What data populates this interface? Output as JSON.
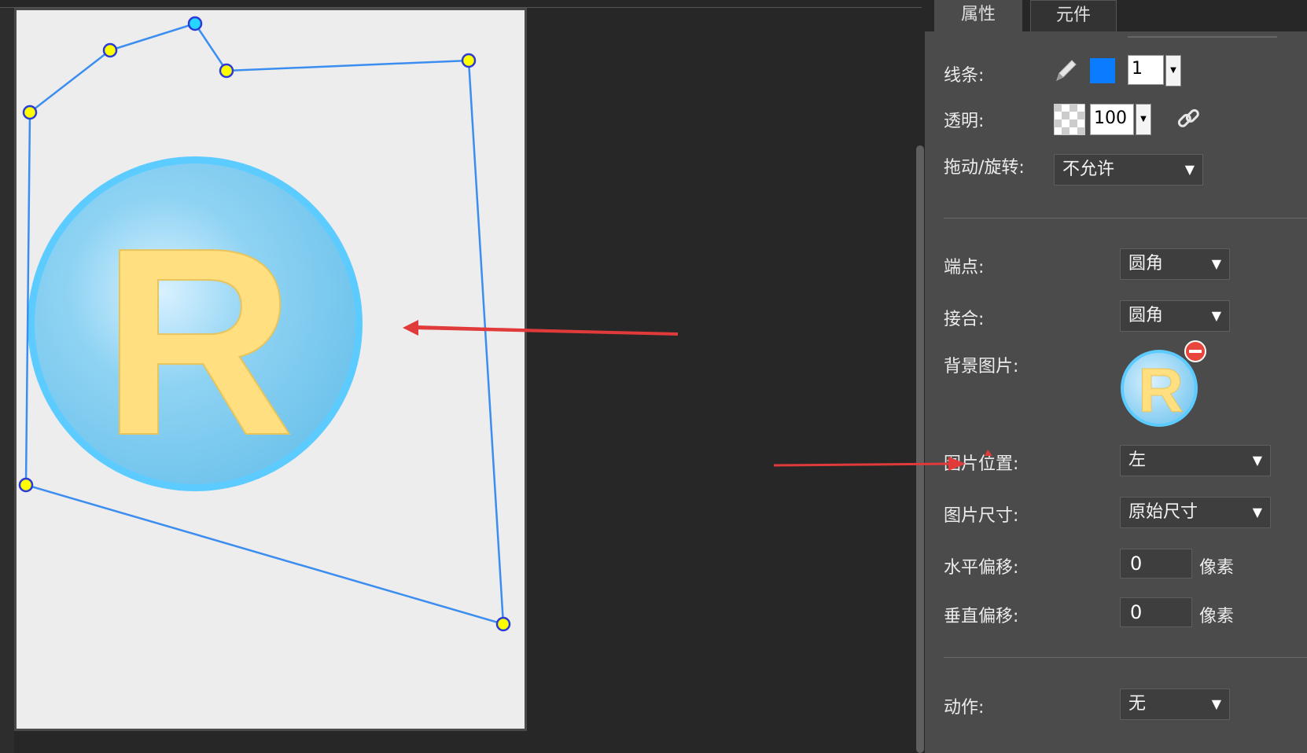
{
  "tabs": {
    "properties": "属性",
    "components": "元件"
  },
  "colors": {
    "stroke": "#0a7cff",
    "panel_bg": "#4b4b4b",
    "canvas_bg": "#272727",
    "page_bg": "#ededed",
    "handle_fill": "#ffff00",
    "handle_active_fill": "#27d6ff",
    "annotation_arrow": "#e03a3a"
  },
  "props": {
    "stroke": {
      "label": "线条:",
      "icon": "pencil-icon",
      "width_value": "1"
    },
    "opacity": {
      "label": "透明:",
      "icon": "checker-icon",
      "value": "100",
      "link_icon": "link-icon"
    },
    "drag_rotate": {
      "label": "拖动/旋转:",
      "value": "不允许"
    },
    "cap": {
      "label": "端点:",
      "value": "圆角"
    },
    "join": {
      "label": "接合:",
      "value": "圆角"
    },
    "bg_image": {
      "label": "背景图片:",
      "thumb_letter": "R",
      "remove_icon": "remove-icon"
    },
    "image_position": {
      "label": "图片位置:",
      "value": "左"
    },
    "image_size": {
      "label": "图片尺寸:",
      "value": "原始尺寸"
    },
    "offset_x": {
      "label": "水平偏移:",
      "value": "0",
      "unit": "像素"
    },
    "offset_y": {
      "label": "垂直偏移:",
      "value": "0",
      "unit": "像素"
    },
    "action": {
      "label": "动作:",
      "value": "无"
    }
  },
  "canvas": {
    "logo_letter": "R"
  }
}
